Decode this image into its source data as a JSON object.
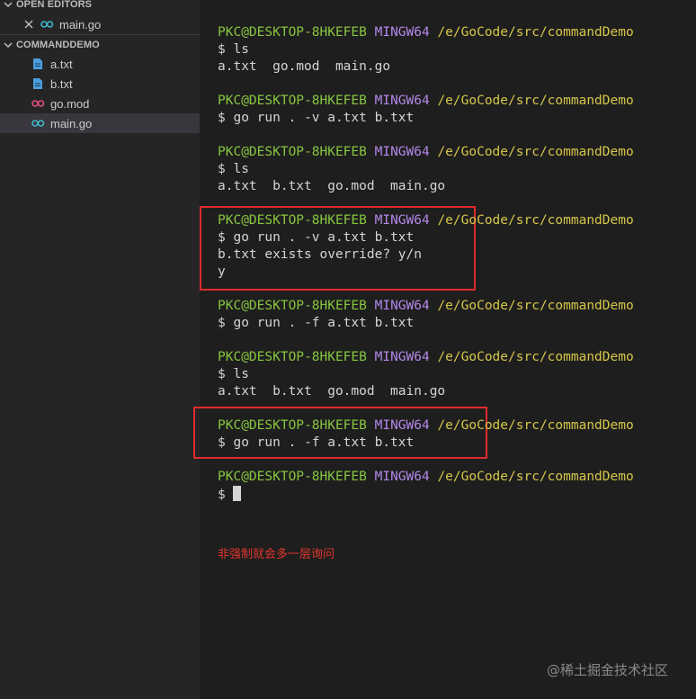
{
  "sidebar": {
    "open_editors_label": "OPEN EDITORS",
    "open_editor_file": "main.go",
    "project_label": "COMMANDDEMO",
    "files": [
      {
        "name": "a.txt",
        "icon": "text-file-icon"
      },
      {
        "name": "b.txt",
        "icon": "text-file-icon"
      },
      {
        "name": "go.mod",
        "icon": "go-mod-icon"
      },
      {
        "name": "main.go",
        "icon": "go-file-icon",
        "selected": true
      }
    ]
  },
  "terminal": {
    "user": "PKC@DESKTOP-8HKEFEB",
    "system": "MINGW64",
    "path": "/e/GoCode/src/commandDemo",
    "blocks": [
      {
        "command": "$ ls",
        "output": [
          "a.txt  go.mod  main.go"
        ]
      },
      {
        "command": "$ go run . -v a.txt b.txt",
        "output": []
      },
      {
        "command": "$ ls",
        "output": [
          "a.txt  b.txt  go.mod  main.go"
        ]
      },
      {
        "command": "$ go run . -v a.txt b.txt",
        "output": [
          "b.txt exists override? y/n",
          "y"
        ]
      },
      {
        "command": "$ go run . -f a.txt b.txt",
        "output": []
      },
      {
        "command": "$ ls",
        "output": [
          "a.txt  b.txt  go.mod  main.go"
        ]
      },
      {
        "command": "$ go run . -f a.txt b.txt",
        "output": []
      },
      {
        "command": "$ ",
        "output": []
      }
    ]
  },
  "annotation": {
    "note": "非强制就会多一层询问",
    "highlight_color": "#e02b2b"
  },
  "watermark": "@稀土掘金技术社区",
  "colors": {
    "user": "#87c540",
    "system": "#b487e8",
    "path": "#d6c64a",
    "sidebar_bg": "#252526",
    "terminal_bg": "#1e1e1e"
  }
}
